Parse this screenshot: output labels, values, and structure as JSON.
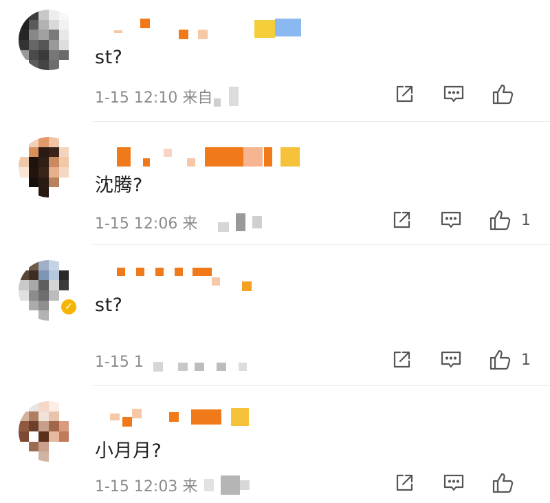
{
  "comments": [
    {
      "text": "st?",
      "meta_visible": "1-15 12:10  来自",
      "likes": "",
      "verified": false
    },
    {
      "text": "沈腾?",
      "meta_visible": "1-15 12:06  来",
      "likes": "1",
      "verified": false
    },
    {
      "text": "st?",
      "meta_visible": "1-15 1",
      "likes": "1",
      "verified": true
    },
    {
      "text": "小月月?",
      "meta_visible": "1-15 12:03  来",
      "likes": "",
      "verified": false
    }
  ],
  "icons": {
    "share": "share-icon",
    "comment": "comment-icon",
    "like": "thumbs-up-icon",
    "verified": "verified-badge-icon"
  },
  "colors": {
    "username_blur": "#f07a1a",
    "text": "#1f1f1f",
    "meta": "#8a8a8a",
    "verified": "#f5b400"
  }
}
